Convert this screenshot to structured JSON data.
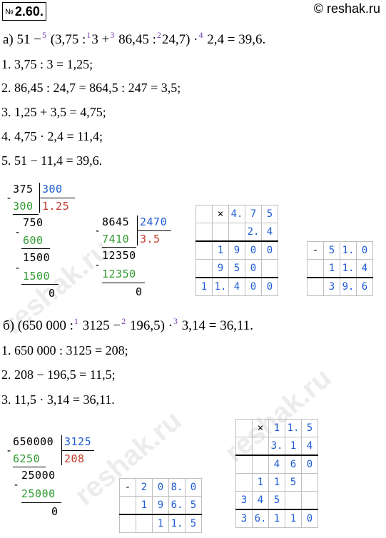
{
  "header": {
    "problem_number_prefix": "№",
    "problem_number": "2.60.",
    "site": "© reshak.ru"
  },
  "part_a": {
    "eq_prefix": "а) 51 −",
    "o5": "5",
    "p1": "(3,75 :",
    "o1": "1",
    "p2": "3 +",
    "o3": "3",
    "p3": "86,45 :",
    "o2": "2",
    "p4": "24,7) ·",
    "o4": "4",
    "p5": "2,4 = 39,6.",
    "steps": [
      "1.  3,75 : 3 = 1,25;",
      "2.  86,45 : 24,7 = 864,5 : 247 = 3,5;",
      "3.  1,25 + 3,5 = 4,75;",
      "4.  4,75 · 2,4 = 11,4;",
      "5.  51 − 11,4 = 39,6."
    ]
  },
  "div1": {
    "dividend": "375",
    "divisor": "300",
    "sub1": "300",
    "quotient": "1.25",
    "r1": "750",
    "sub2": "600",
    "r2": "1500",
    "sub3": "1500",
    "rem": "0",
    "minus": "-"
  },
  "div2": {
    "dividend": "8645",
    "divisor": "2470",
    "sub1": "7410",
    "quotient": "3.5",
    "r1": "12350",
    "sub2": "12350",
    "rem": "0",
    "minus": "-"
  },
  "mult_a": {
    "rows": [
      [
        "",
        "×",
        "4.",
        "7",
        "5"
      ],
      [
        "",
        "",
        "",
        "2.",
        "4"
      ],
      [
        "",
        "1",
        "9",
        "0",
        "0"
      ],
      [
        "",
        "9",
        "5",
        "0",
        ""
      ],
      [
        "1",
        "1.",
        "4",
        "0",
        "0"
      ]
    ]
  },
  "sub_a": {
    "rows": [
      [
        "-",
        "5",
        "1.",
        "0"
      ],
      [
        "",
        "1",
        "1.",
        "4"
      ],
      [
        "",
        "3",
        "9.",
        "6"
      ]
    ]
  },
  "part_b": {
    "eq_prefix": "б) (650 000 :",
    "o1": "1",
    "p1": "3125 −",
    "o2": "2",
    "p2": "196,5) ·",
    "o3": "3",
    "p3": "3,14 = 36,11.",
    "steps": [
      "1.  650 000 : 3125 = 208;",
      "2.  208 − 196,5 = 11,5;",
      "3.  11,5 · 3,14 = 36,11."
    ]
  },
  "div3": {
    "dividend": "650000",
    "divisor": "3125",
    "sub1": "6250",
    "quotient": "208",
    "r1": "25000",
    "sub2": "25000",
    "rem": "0",
    "minus": "-"
  },
  "sub_b": {
    "rows": [
      [
        "-",
        "2",
        "0",
        "8.",
        "0"
      ],
      [
        "",
        "1",
        "9",
        "6.",
        "5"
      ],
      [
        "",
        "",
        "1",
        "1.",
        "5"
      ]
    ]
  },
  "mult_b": {
    "rows": [
      [
        "",
        "×",
        "1",
        "1.",
        "5"
      ],
      [
        "",
        "",
        "3.",
        "1",
        "4"
      ],
      [
        "",
        "",
        "4",
        "6",
        "0"
      ],
      [
        "",
        "1",
        "1",
        "5",
        ""
      ],
      [
        "3",
        "4",
        "5",
        "",
        ""
      ],
      [
        "3",
        "6.",
        "1",
        "1",
        "0"
      ]
    ]
  },
  "watermark": "reshak.ru"
}
